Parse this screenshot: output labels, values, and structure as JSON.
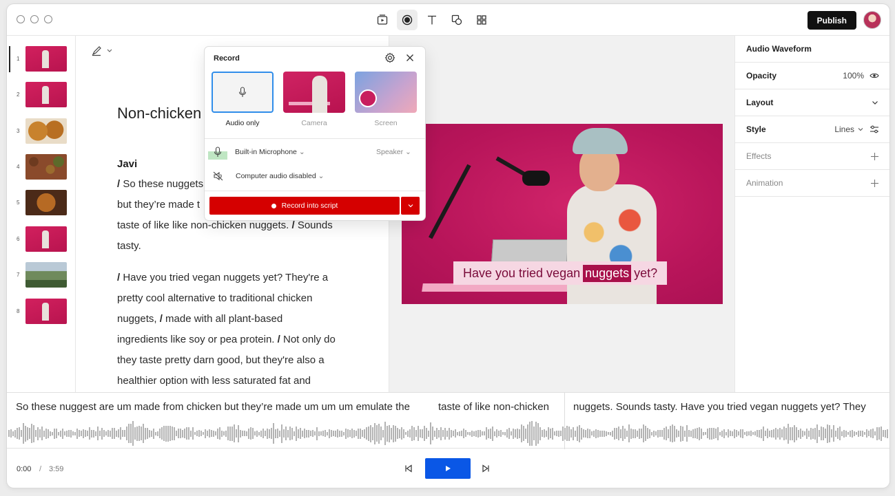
{
  "toolbar": {
    "publish_label": "Publish",
    "tools": [
      "scene-icon",
      "record-icon",
      "text-icon",
      "shapes-icon",
      "grid-icon"
    ]
  },
  "thumbnails": [
    {
      "num": "1",
      "kind": "pink"
    },
    {
      "num": "2",
      "kind": "pink"
    },
    {
      "num": "3",
      "kind": "nugget"
    },
    {
      "num": "4",
      "kind": "beans"
    },
    {
      "num": "5",
      "kind": "nugget2"
    },
    {
      "num": "6",
      "kind": "pink"
    },
    {
      "num": "7",
      "kind": "landscape"
    },
    {
      "num": "8",
      "kind": "pink"
    }
  ],
  "script": {
    "title": "Non-chicken",
    "speaker": "Javi",
    "para1_lines": [
      {
        "slash": "/",
        "text": " So these nuggets"
      },
      {
        "slash": "",
        "text": "but they’re made t"
      },
      {
        "slash": "",
        "text": "taste of like like non-chicken nuggets. ",
        "slash2": "/",
        "text2": " Sounds"
      },
      {
        "slash": "",
        "text": "tasty."
      }
    ],
    "para2_lines": [
      {
        "slash": "/",
        "text": " Have you tried vegan nuggets yet? They're a"
      },
      {
        "slash": "",
        "text": "pretty cool alternative to traditional chicken"
      },
      {
        "slash": "",
        "text": "nuggets, ",
        "slash2": "/",
        "text2": " made with all plant-based"
      },
      {
        "slash": "",
        "text": "ingredients like soy or pea protein. ",
        "slash2": "/",
        "text2": " Not only do"
      },
      {
        "slash": "",
        "text": "they taste pretty darn good, but they're also a"
      },
      {
        "slash": "",
        "text": "healthier option with less saturated fat and"
      }
    ]
  },
  "preview": {
    "caption_before": "Have you tried vegan",
    "caption_highlight": "nuggets",
    "caption_after": "yet?"
  },
  "properties": {
    "header": "Audio Waveform",
    "opacity_label": "Opacity",
    "opacity_value": "100%",
    "layout_label": "Layout",
    "style_label": "Style",
    "style_value": "Lines",
    "effects_label": "Effects",
    "animation_label": "Animation"
  },
  "record": {
    "title": "Record",
    "options": [
      {
        "label": "Audio only",
        "selected": true
      },
      {
        "label": "Camera",
        "selected": false
      },
      {
        "label": "Screen",
        "selected": false
      }
    ],
    "microphone": "Built-in Microphone",
    "speaker": "Speaker",
    "computer_audio": "Computer audio disabled",
    "record_button": "Record into script"
  },
  "timeline": {
    "segment1": "So these nuggest are um made from chicken but they’re made um um um emulate the",
    "segment2": "taste of like non-chicken",
    "segment3": "nuggets. Sounds tasty. Have you tried vegan nuggets yet? They"
  },
  "transport": {
    "current": "0:00",
    "separator": "/",
    "duration": "3:59"
  }
}
